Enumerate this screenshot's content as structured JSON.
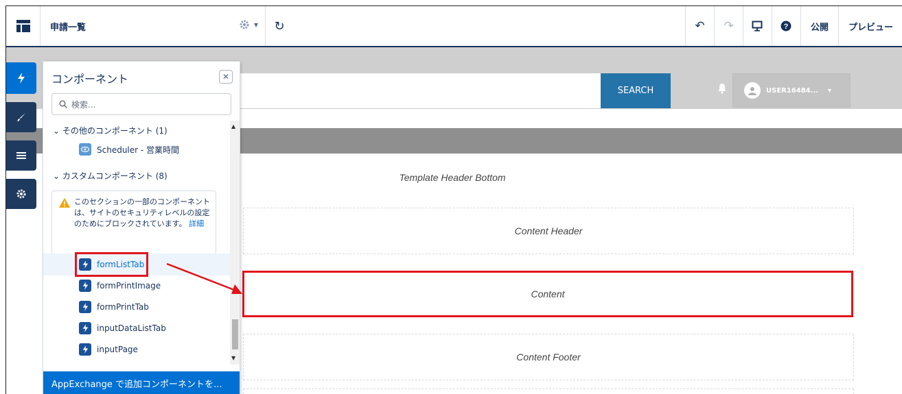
{
  "toolbar": {
    "page_title": "申請一覧",
    "publish_label": "公開",
    "preview_label": "プレビュー"
  },
  "canvas": {
    "search_button": "SEARCH",
    "user_name": "USER16484...",
    "regions": {
      "header_bottom": "Template Header Bottom",
      "content_header": "Content Header",
      "content": "Content",
      "content_footer": "Content Footer"
    }
  },
  "panel": {
    "title": "コンポーネント",
    "search_placeholder": "検索...",
    "section_other": "その他のコンポーネント (1)",
    "scheduler_item": "Scheduler - 営業時間",
    "section_custom": "カスタムコンポーネント (8)",
    "warning_text": "このセクションの一部のコンポーネントは、サイトのセキュリティレベルの設定のためにブロックされています。",
    "warning_link": "詳細",
    "components": [
      "formListTab",
      "formPrintImage",
      "formPrintTab",
      "inputDataListTab",
      "inputPage"
    ],
    "footer": "AppExchange で追加コンポーネントを..."
  },
  "colors": {
    "brand_navy": "#16325c",
    "accent_blue": "#0070d2",
    "search_button": "#2574a9",
    "highlight_red": "#e0151c"
  }
}
